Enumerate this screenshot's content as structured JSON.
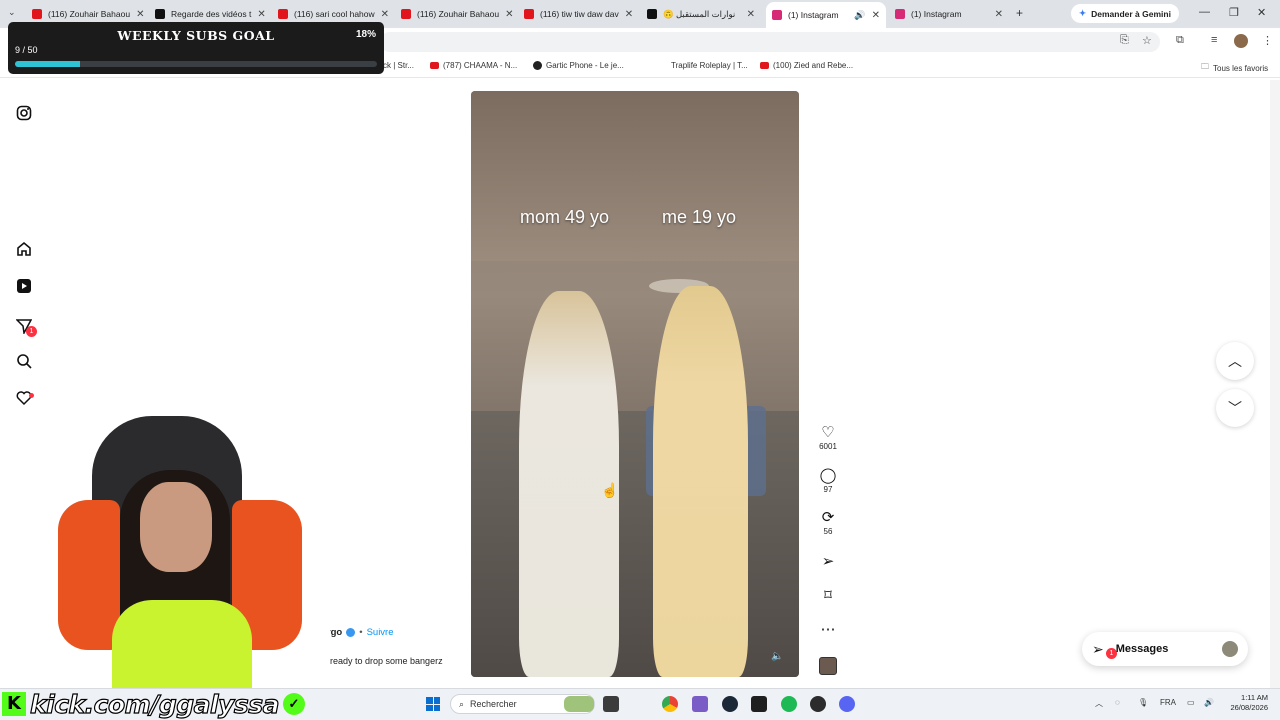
{
  "browser": {
    "tabs": [
      {
        "label": "(116) Zouhair Bahaou",
        "fav_color": "#e0161c"
      },
      {
        "label": "Regarde des vidéos t",
        "fav_color": "#111111"
      },
      {
        "label": "(116) sari cool hahow",
        "fav_color": "#e0161c"
      },
      {
        "label": "(116) Zouhair Bahaou",
        "fav_color": "#e0161c"
      },
      {
        "label": "(116) tiw tiw daw dav",
        "fav_color": "#e0161c"
      },
      {
        "label": "🙃 نوارات المستقبل",
        "fav_color": "#111111"
      },
      {
        "label": "(1) Instagram",
        "fav_color": "#d62976"
      },
      {
        "label": "(1) Instagram",
        "fav_color": "#d62976"
      }
    ],
    "gemini_label": "Demander à Gemini",
    "bookmarks": [
      {
        "label": "ck | Str..."
      },
      {
        "label": "(787) CHAAMA - N..."
      },
      {
        "label": "Gartic Phone - Le je..."
      },
      {
        "label": "Traplife Roleplay | T..."
      },
      {
        "label": "(100) Zied and Rebe..."
      }
    ],
    "all_bookmarks_label": "Tous les favoris"
  },
  "instagram": {
    "overlay_left": "mom 49 yo",
    "overlay_right": "me 19 yo",
    "likes": "6001",
    "comments": "97",
    "reposts": "56",
    "username": "aygraygo",
    "follow_label": "Suivre",
    "caption": "ready to drop some bangerz",
    "notification_count": "1",
    "messages_label": "Messages",
    "messages_badge": "1"
  },
  "stream": {
    "goal_title": "WEEKLY SUBS GOAL",
    "goal_percent": "18%",
    "goal_count": "9 / 50",
    "goal_progress": 0.18,
    "kick_url": "kick.com/ggalyssa"
  },
  "taskbar": {
    "search_placeholder": "Rechercher",
    "language": "FRA",
    "time": "1:11 AM",
    "date": "26/08/2026"
  }
}
